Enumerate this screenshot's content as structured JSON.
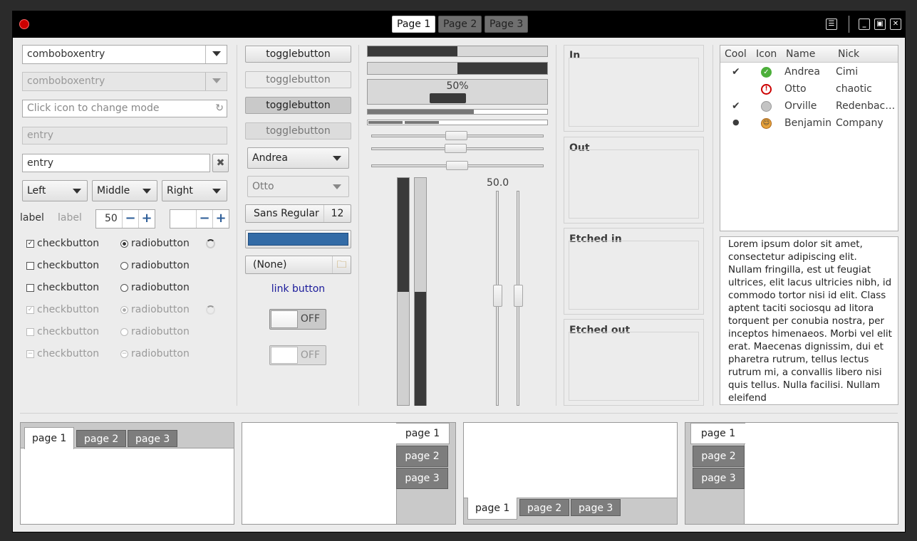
{
  "header": {
    "tabs": [
      "Page 1",
      "Page 2",
      "Page 3"
    ]
  },
  "col1": {
    "combo1": "comboboxentry",
    "combo2": "comboboxentry",
    "icon_entry_placeholder": "Click icon to change mode",
    "entry_disabled": "entry",
    "entry": "entry",
    "dropdowns": [
      "Left",
      "Middle",
      "Right"
    ],
    "labels": [
      "label",
      "label"
    ],
    "spin_value": "50",
    "checks": [
      "checkbutton",
      "checkbutton",
      "checkbutton",
      "checkbutton",
      "checkbutton",
      "checkbutton"
    ],
    "radios": [
      "radiobutton",
      "radiobutton",
      "radiobutton",
      "radiobutton",
      "radiobutton",
      "radiobutton"
    ]
  },
  "col2": {
    "toggles": [
      "togglebutton",
      "togglebutton",
      "togglebutton",
      "togglebutton"
    ],
    "combo_andrea": "Andrea",
    "combo_otto": "Otto",
    "font_name": "Sans Regular",
    "font_size": "12",
    "color_hex": "#336ba6",
    "file_none": "(None)",
    "link": "link button",
    "switch1": "OFF",
    "switch2": "OFF"
  },
  "col3": {
    "progress_values": [
      0.5,
      0.5,
      0.5
    ],
    "percent_label": "50%",
    "scale_value": "50.0"
  },
  "frames": {
    "in": "In",
    "out": "Out",
    "etched_in": "Etched in",
    "etched_out": "Etched out"
  },
  "tree": {
    "columns": [
      "Cool",
      "Icon",
      "Name",
      "Nick"
    ],
    "rows": [
      {
        "cool": "✔",
        "icon": "ok-icon",
        "name": "Andrea",
        "nick": "Cimi"
      },
      {
        "cool": "",
        "icon": "error-icon",
        "name": "Otto",
        "nick": "chaotic"
      },
      {
        "cool": "✔",
        "icon": "disabled-icon",
        "name": "Orville",
        "nick": "Redenbac…"
      },
      {
        "cool": "●",
        "icon": "face-icon",
        "name": "Benjamin",
        "nick": "Company"
      }
    ]
  },
  "textview": "Lorem ipsum dolor sit amet, consectetur adipiscing elit. Nullam fringilla, est ut feugiat ultrices, elit lacus ultricies nibh, id commodo tortor nisi id elit. Class aptent taciti sociosqu ad litora torquent per conubia nostra, per inceptos himenaeos. Morbi vel elit erat. Maecenas dignissim, dui et pharetra rutrum, tellus lectus rutrum mi, a convallis libero nisi quis tellus. Nulla facilisi. Nullam eleifend",
  "notebooks": {
    "tabs": [
      "page 1",
      "page 2",
      "page 3"
    ]
  }
}
